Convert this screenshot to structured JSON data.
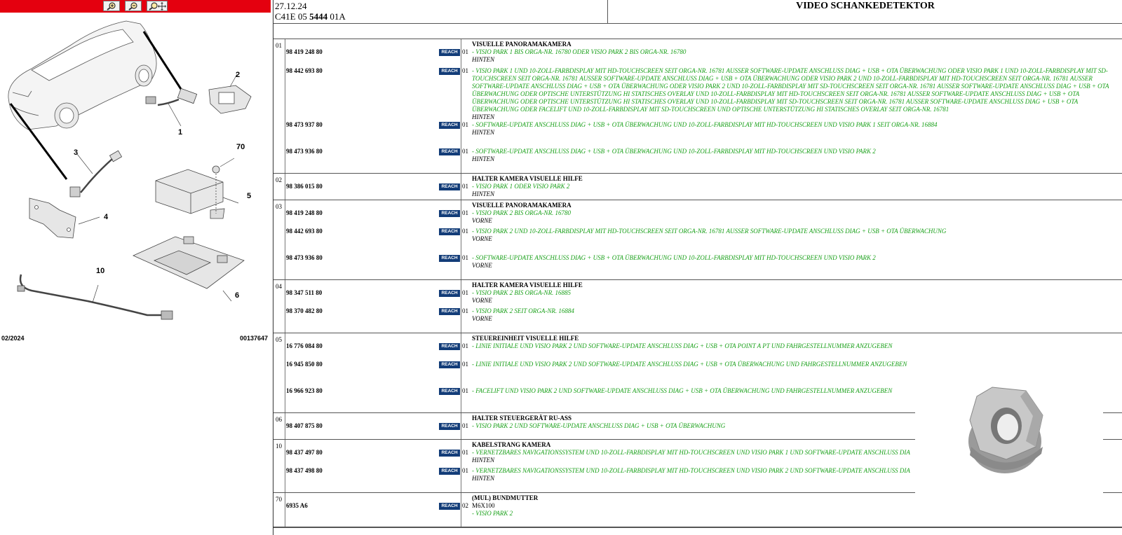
{
  "toolbar": {
    "zoom_in_icon": "zoom-in-icon",
    "zoom_out_icon": "zoom-out-icon",
    "zoom_fit_icon": "zoom-pan-icon",
    "background": "#e4000f"
  },
  "diagram": {
    "callouts": [
      "1",
      "2",
      "3",
      "4",
      "5",
      "6",
      "10",
      "70"
    ],
    "date": "02/2024",
    "ref": "00137647"
  },
  "header": {
    "date": "27.12.24",
    "code_prefix": "C41E 05 ",
    "code_bold": "5444",
    "code_suffix": " 01A",
    "title": "VIDEO SCHANKEDETEKTOR"
  },
  "badge": "REACH",
  "colors": {
    "green": "#19a019",
    "reach": "#123c78",
    "toolbar": "#e4000f"
  },
  "groups": [
    {
      "num": "01",
      "title": "VISUELLE PANORAMAKAMERA",
      "parts": [
        {
          "pn": "98 419 248 80",
          "qty": "01",
          "desc": "- VISIO PARK 1 BIS ORGA-NR. 16780 ODER VISIO PARK 2 BIS ORGA-NR. 16780",
          "loc": "HINTEN"
        },
        {
          "pn": "98 442 693 80",
          "qty": "01",
          "desc": "- VISIO PARK 1 UND 10-ZOLL-FARBDISPLAY MIT HD-TOUCHSCREEN SEIT ORGA-NR. 16781 AUSSER SOFTWARE-UPDATE ANSCHLUSS DIAG + USB + OTA ÜBERWACHUNG ODER VISIO PARK 1 UND 10-ZOLL-FARBDISPLAY MIT SD-TOUCHSCREEN SEIT ORGA-NR. 16781 AUSSER SOFTWARE-UPDATE ANSCHLUSS DIAG + USB + OTA ÜBERWACHUNG ODER VISIO PARK 2 UND 10-ZOLL-FARBDISPLAY MIT HD-TOUCHSCREEN SEIT ORGA-NR. 16781 AUSSER SOFTWARE-UPDATE ANSCHLUSS DIAG + USB + OTA ÜBERWACHUNG ODER VISIO PARK 2 UND 10-ZOLL-FARBDISPLAY MIT SD-TOUCHSCREEN SEIT ORGA-NR. 16781 AUSSER SOFTWARE-UPDATE ANSCHLUSS DIAG + USB + OTA ÜBERWACHUNG ODER OPTISCHE UNTERSTÜTZUNG HI STATISCHES OVERLAY UND 10-ZOLL-FARBDISPLAY MIT HD-TOUCHSCREEN SEIT ORGA-NR. 16781 AUSSER SOFTWARE-UPDATE ANSCHLUSS DIAG + USB + OTA ÜBERWACHUNG ODER OPTISCHE UNTERSTÜTZUNG HI STATISCHES OVERLAY UND 10-ZOLL-FARBDISPLAY MIT SD-TOUCHSCREEN SEIT ORGA-NR. 16781 AUSSER SOFTWARE-UPDATE ANSCHLUSS DIAG + USB + OTA ÜBERWACHUNG ODER FACELIFT UND 10-ZOLL-FARBDISPLAY MIT SD-TOUCHSCREEN UND OPTISCHE UNTERSTÜTZUNG HI STATISCHES OVERLAY SEIT ORGA-NR. 16781",
          "loc": "HINTEN"
        },
        {
          "pn": "98 473 937 80",
          "qty": "01",
          "desc": "- SOFTWARE-UPDATE ANSCHLUSS DIAG + USB + OTA ÜBERWACHUNG UND 10-ZOLL-FARBDISPLAY MIT HD-TOUCHSCREEN UND VISIO PARK 1 SEIT ORGA-NR. 16884",
          "loc": "HINTEN"
        },
        {
          "pn": "98 473 936 80",
          "qty": "01",
          "desc": "- SOFTWARE-UPDATE ANSCHLUSS DIAG + USB + OTA ÜBERWACHUNG UND 10-ZOLL-FARBDISPLAY MIT HD-TOUCHSCREEN UND VISIO PARK 2",
          "loc": "HINTEN"
        }
      ]
    },
    {
      "num": "02",
      "title": "HALTER KAMERA VISUELLE HILFE",
      "parts": [
        {
          "pn": "98 386 015 80",
          "qty": "01",
          "desc": "- VISIO PARK 1 ODER VISIO PARK 2",
          "loc": "HINTEN"
        }
      ]
    },
    {
      "num": "03",
      "title": "VISUELLE PANORAMAKAMERA",
      "parts": [
        {
          "pn": "98 419 248 80",
          "qty": "01",
          "desc": "- VISIO PARK 2 BIS ORGA-NR. 16780",
          "loc": "VORNE"
        },
        {
          "pn": "98 442 693 80",
          "qty": "01",
          "desc": "- VISIO PARK 2 UND 10-ZOLL-FARBDISPLAY MIT HD-TOUCHSCREEN SEIT ORGA-NR. 16781 AUSSER SOFTWARE-UPDATE ANSCHLUSS DIAG + USB + OTA ÜBERWACHUNG",
          "loc": "VORNE"
        },
        {
          "pn": "98 473 936 80",
          "qty": "01",
          "desc": "- SOFTWARE-UPDATE ANSCHLUSS DIAG + USB + OTA ÜBERWACHUNG UND 10-ZOLL-FARBDISPLAY MIT HD-TOUCHSCREEN UND VISIO PARK 2",
          "loc": "VORNE"
        }
      ]
    },
    {
      "num": "04",
      "title": "HALTER KAMERA VISUELLE HILFE",
      "parts": [
        {
          "pn": "98 347 511 80",
          "qty": "01",
          "desc": "- VISIO PARK 2 BIS ORGA-NR. 16885",
          "loc": "VORNE"
        },
        {
          "pn": "98 370 482 80",
          "qty": "01",
          "desc": "- VISIO PARK 2 SEIT ORGA-NR. 16884",
          "loc": "VORNE"
        }
      ]
    },
    {
      "num": "05",
      "title": "STEUEREINHEIT VISUELLE HILFE",
      "parts": [
        {
          "pn": "16 776 084 80",
          "qty": "01",
          "desc": "- LINIE INITIALE UND VISIO PARK 2 UND SOFTWARE-UPDATE ANSCHLUSS DIAG + USB + OTA POINT A PT UND FAHRGESTELLNUMMER ANZUGEBEN"
        },
        {
          "pn": "16 945 850 80",
          "qty": "01",
          "desc": "- LINIE INITIALE UND VISIO PARK 2 UND SOFTWARE-UPDATE ANSCHLUSS DIAG + USB + OTA ÜBERWACHUNG UND FAHRGESTELLNUMMER ANZUGEBEN"
        },
        {
          "pn": "16 966 923 80",
          "qty": "01",
          "desc": "- FACELIFT UND VISIO PARK 2 UND SOFTWARE-UPDATE ANSCHLUSS DIAG + USB + OTA ÜBERWACHUNG UND FAHRGESTELLNUMMER ANZUGEBEN"
        }
      ]
    },
    {
      "num": "06",
      "title": "HALTER STEUERGERÄT RU-ASS",
      "parts": [
        {
          "pn": "98 407 875 80",
          "qty": "01",
          "desc": "- VISIO PARK 2 UND SOFTWARE-UPDATE ANSCHLUSS DIAG + USB + OTA ÜBERWACHUNG"
        }
      ]
    },
    {
      "num": "10",
      "title": "KABELSTRANG KAMERA",
      "parts": [
        {
          "pn": "98 437 497 80",
          "qty": "01",
          "desc": "- VERNETZBARES NAVIGATIONSSYSTEM UND 10-ZOLL-FARBDISPLAY MIT HD-TOUCHSCREEN UND VISIO PARK 1 UND SOFTWARE-UPDATE ANSCHLUSS DIA",
          "loc": "HINTEN"
        },
        {
          "pn": "98 437 498 80",
          "qty": "01",
          "desc": "- VERNETZBARES NAVIGATIONSSYSTEM UND 10-ZOLL-FARBDISPLAY MIT HD-TOUCHSCREEN UND VISIO PARK 2 UND SOFTWARE-UPDATE ANSCHLUSS DIA",
          "loc": "HINTEN"
        }
      ]
    },
    {
      "num": "70",
      "title": "(MUL) BUNDMUTTER",
      "parts": [
        {
          "pn": "6935 A6",
          "qty": "02",
          "spec": "M6X100",
          "desc": "- VISIO PARK 2"
        }
      ]
    }
  ]
}
